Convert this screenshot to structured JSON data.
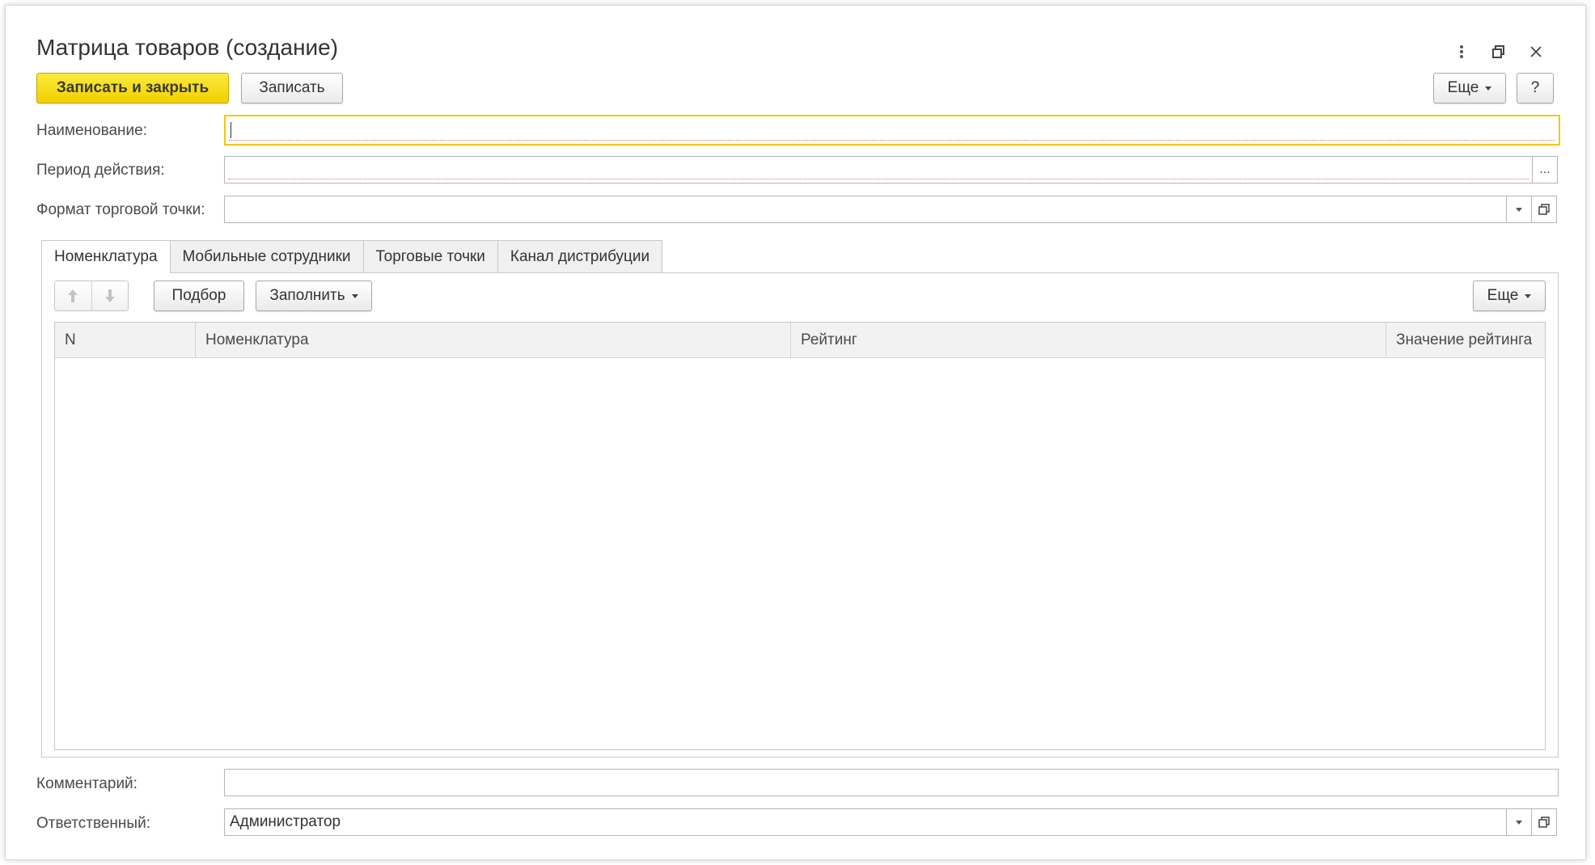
{
  "window": {
    "title": "Матрица товаров (создание)",
    "controls": [
      "more-icon",
      "restore-icon",
      "close-icon"
    ]
  },
  "toolbar": {
    "save_close_label": "Записать и закрыть",
    "save_label": "Записать",
    "more_label": "Еще",
    "help_label": "?"
  },
  "form": {
    "name": {
      "label": "Наименование:",
      "value": ""
    },
    "period": {
      "label": "Период действия:",
      "value": "",
      "button": "..."
    },
    "format": {
      "label": "Формат торговой точки:",
      "value": ""
    },
    "comment": {
      "label": "Комментарий:",
      "value": ""
    },
    "responsible": {
      "label": "Ответственный:",
      "value": "Администратор"
    }
  },
  "tabs": [
    {
      "label": "Номенклатура",
      "active": true
    },
    {
      "label": "Мобильные сотрудники",
      "active": false
    },
    {
      "label": "Торговые точки",
      "active": false
    },
    {
      "label": "Канал дистрибуции",
      "active": false
    }
  ],
  "table_toolbar": {
    "pick_label": "Подбор",
    "fill_label": "Заполнить",
    "more_label": "Еще"
  },
  "table": {
    "columns": [
      "N",
      "Номенклатура",
      "Рейтинг",
      "Значение рейтинга"
    ],
    "rows": []
  },
  "colors": {
    "accent": "#f5c800",
    "primary_button": "#f1d000",
    "required_underline": "#e07070"
  }
}
